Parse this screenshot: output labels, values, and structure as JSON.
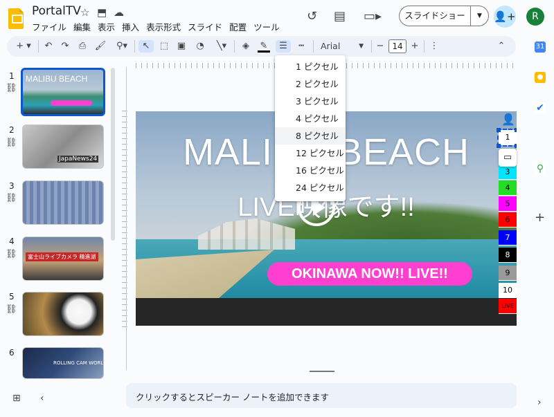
{
  "header": {
    "doc_title": "PortalTV",
    "menu": [
      "ファイル",
      "編集",
      "表示",
      "挿入",
      "表示形式",
      "スライド",
      "配置",
      "ツール"
    ],
    "slideshow_label": "スライドショー",
    "avatar_initial": "R"
  },
  "toolbar": {
    "font": "Arial",
    "font_size": "14"
  },
  "border_weight_menu": {
    "options": [
      "1 ピクセル",
      "2 ピクセル",
      "3 ピクセル",
      "4 ピクセル",
      "8 ピクセル",
      "12 ピクセル",
      "16 ピクセル",
      "24 ピクセル"
    ],
    "highlighted": "8 ピクセル"
  },
  "filmstrip": {
    "slide_numbers": [
      "1",
      "2",
      "3",
      "4",
      "5",
      "6"
    ],
    "thumb_captions": [
      "MALIBU BEACH",
      "JapaNews24",
      "",
      "富士山ライブカメラ 精進湖",
      "",
      "ROLLING CAM WORLD"
    ]
  },
  "slide": {
    "title": "MALIBU BEACH",
    "subtitle": "LIVE映像です!!",
    "pill_text": "OKINAWA NOW!! LIVE!!",
    "channel_bar": [
      "1",
      "2",
      "3",
      "4",
      "5",
      "6",
      "7",
      "8",
      "9",
      "10",
      "LIVE"
    ],
    "channel_colors": [
      "#ffffff",
      "#ffffff",
      "#00e5ff",
      "#22dd22",
      "#ff00ff",
      "#ff0000",
      "#0000ff",
      "#000000",
      "#999999",
      "#ffffff",
      "#ff0000"
    ]
  },
  "notes_placeholder": "クリックするとスピーカー ノートを追加できます",
  "colors": {
    "accent": "#0b57d0",
    "pill": "#ff3fd0"
  }
}
